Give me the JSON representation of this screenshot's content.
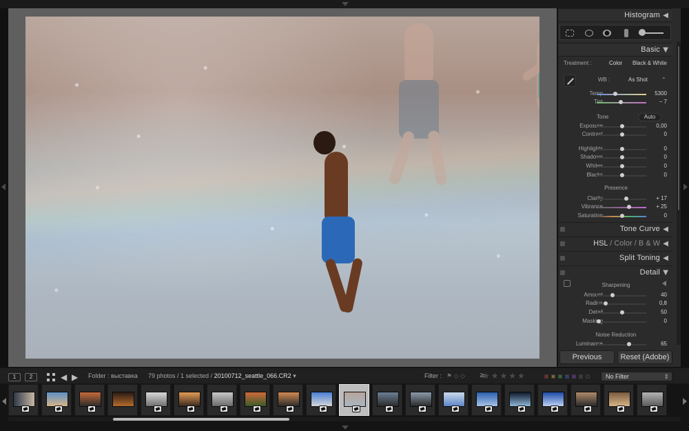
{
  "right_panel": {
    "histogram_title": "Histogram",
    "basic_title": "Basic",
    "treatment_label": "Treatment :",
    "treatment_color": "Color",
    "treatment_bw": "Black & White",
    "wb_label": "WB :",
    "wb_value": "As Shot",
    "temp_label": "Temp",
    "temp_value": "5300",
    "tint_label": "Tint",
    "tint_value": "− 7",
    "tone_label": "Tone",
    "auto_label": "Auto",
    "exposure_label": "Exposure",
    "exposure_value": "0,00",
    "contrast_label": "Contrast",
    "contrast_value": "0",
    "highlights_label": "Highlights",
    "highlights_value": "0",
    "shadows_label": "Shadows",
    "shadows_value": "0",
    "whites_label": "Whites",
    "whites_value": "0",
    "blacks_label": "Blacks",
    "blacks_value": "0",
    "presence_label": "Presence",
    "clarity_label": "Clarity",
    "clarity_value": "+ 17",
    "vibrance_label": "Vibrance",
    "vibrance_value": "+ 25",
    "saturation_label": "Saturation",
    "saturation_value": "0",
    "tone_curve_title": "Tone Curve",
    "hsl_title": "HSL",
    "hsl_color": "Color",
    "hsl_bw": "B & W",
    "split_toning_title": "Split Toning",
    "detail_title": "Detail",
    "sharpening_label": "Sharpening",
    "amount_label": "Amount",
    "amount_value": "40",
    "radius_label": "Radius",
    "radius_value": "0,8",
    "detail_label": "Detail",
    "detail_value": "50",
    "masking_label": "Masking",
    "masking_value": "0",
    "noise_reduction_label": "Noise Reduction",
    "luminance_label": "Luminance",
    "luminance_value": "65",
    "previous_button": "Previous",
    "reset_button": "Reset (Adobe)"
  },
  "filmstrip_bar": {
    "view_1": "1",
    "view_2": "2",
    "folder_label": "Folder :",
    "folder_name": "выставка",
    "photo_count": "79 photos / 1 selected /",
    "file_name": "20100712_seattle_066.CR2",
    "filter_label": "Filter :",
    "filter_value": "No Filter",
    "ge_symbol": "≥"
  },
  "colors": {
    "accent_blue": "#2b69b8",
    "panel_bg": "#2b2b2b"
  }
}
